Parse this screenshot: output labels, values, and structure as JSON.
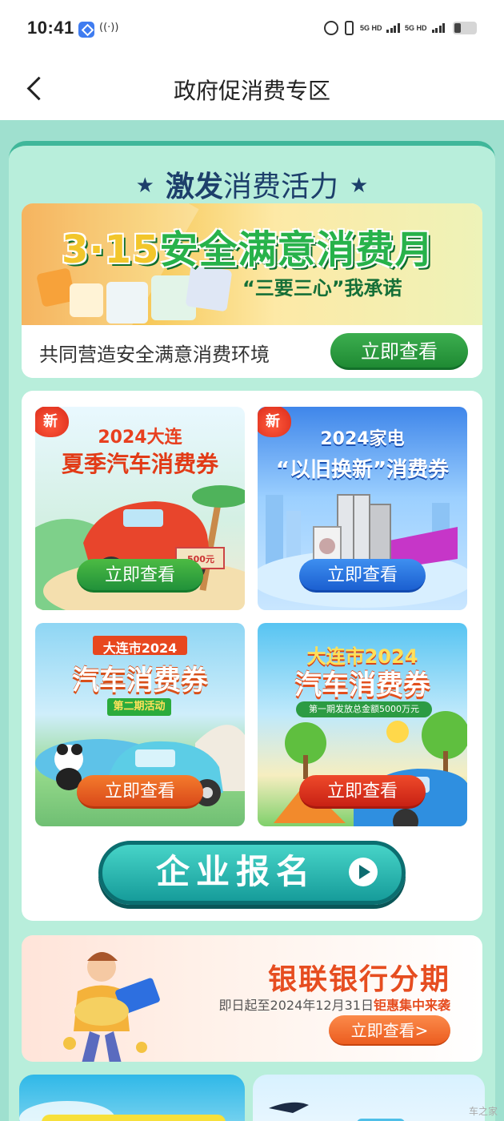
{
  "status_bar": {
    "time": "10:41",
    "nfc": "((·))",
    "net1": "5G HD",
    "net2": "5G HD"
  },
  "nav": {
    "title": "政府促消费专区",
    "back_icon": "chevron-left-icon"
  },
  "section": {
    "star_left": "★",
    "title_bold": "激发",
    "title_rest": "消费活力",
    "star_right": "★"
  },
  "banner_315": {
    "title_num": "3·15",
    "title_text": "安全满意消费月",
    "subtitle": "“三要三心”我承诺",
    "description": "共同营造安全满意消费环境",
    "button": "立即查看"
  },
  "tiles": [
    {
      "badge": "新",
      "year": "2024大连",
      "name": "夏季汽车消费券",
      "button": "立即查看",
      "price_tag": "500元"
    },
    {
      "badge": "新",
      "year": "2024家电",
      "name": "“以旧换新”消费券",
      "button": "立即查看"
    },
    {
      "year": "大连市2024",
      "name": "汽车消费券",
      "phase": "第二期活动",
      "button": "立即查看"
    },
    {
      "year": "大连市2024",
      "name": "汽车消费券",
      "note": "第一期发放总金额5000万元",
      "button": "立即查看"
    }
  ],
  "enroll": {
    "label": "企业报名",
    "icon": "play-circle-icon"
  },
  "unionpay": {
    "title": "银联银行分期",
    "sub_prefix": "即日起至2024年12月31日",
    "sub_highlight": "钜惠集中来袭",
    "button": "立即查看>"
  },
  "watermark": "车之家",
  "colors": {
    "panel_bg": "#b8eedb",
    "page_bg": "#9fe0cf",
    "header_text": "#1d3f6b",
    "green_button": "#1f8a33",
    "blue_button": "#1b5fd0",
    "orange_button": "#d9491a",
    "red_button": "#c82114",
    "enroll_button": "#169c9a",
    "unionpay_accent": "#e64d20"
  }
}
